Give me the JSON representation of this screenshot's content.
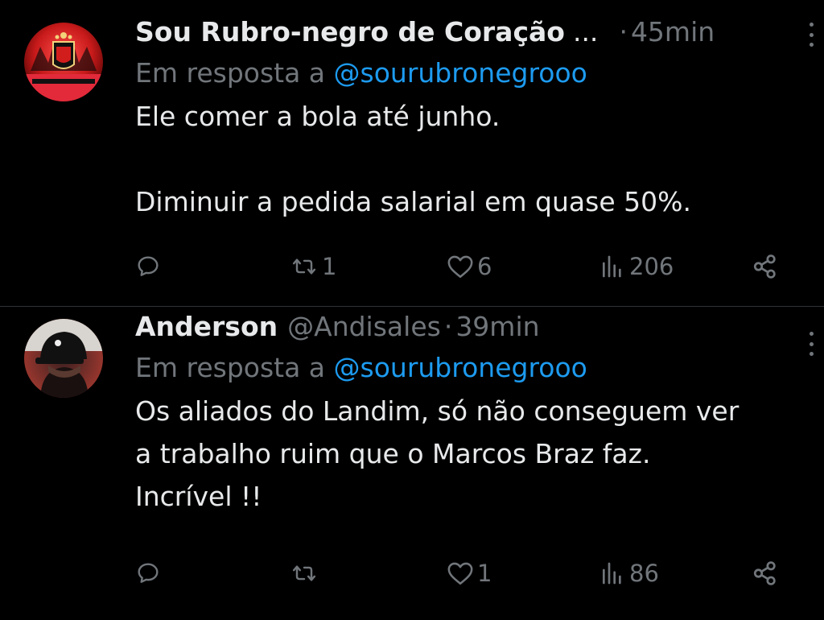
{
  "tweets": [
    {
      "author_name": "Sou Rubro-negro de Coração",
      "name_truncation": "...",
      "handle": "",
      "separator": "·",
      "time": "45min",
      "reply_prefix": "Em resposta a",
      "reply_to": "@sourubronegrooo",
      "text": "Ele comer a bola até junho.\n\nDiminuir a pedida salarial em quase 50%.",
      "replies": "",
      "retweets": "1",
      "likes": "6",
      "views": "206",
      "avatar_caption": "SOU RUBRO-NEGRO DE CORAÇÃO"
    },
    {
      "author_name": "Anderson",
      "handle": "@Andisales",
      "separator": "·",
      "time": "39min",
      "reply_prefix": "Em resposta a",
      "reply_to": "@sourubronegrooo",
      "text": "Os aliados do Landim, só não conseguem ver\na trabalho ruim que o Marcos Braz faz.\nIncrível !!",
      "replies": "",
      "retweets": "",
      "likes": "1",
      "views": "86"
    }
  ],
  "icons": {
    "reply": "reply-icon",
    "retweet": "retweet-icon",
    "like": "heart-icon",
    "views": "views-icon",
    "share": "share-icon",
    "more": "more-vertical-icon"
  },
  "colors": {
    "background": "#000000",
    "text": "#e7e9ea",
    "muted": "#71767b",
    "link": "#1d9bf0",
    "divider": "#2f3336"
  }
}
